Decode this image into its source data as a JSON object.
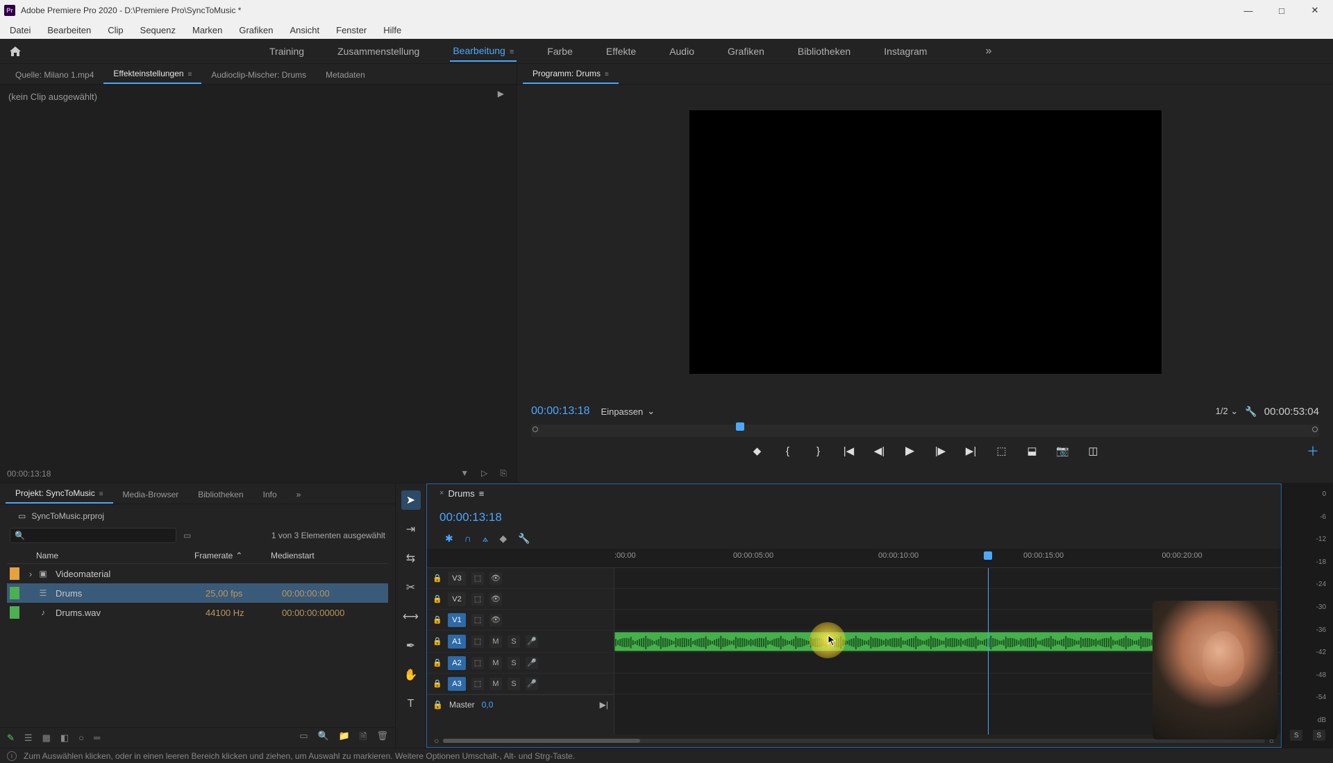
{
  "titlebar": {
    "app_icon_text": "Pr",
    "title": "Adobe Premiere Pro 2020 - D:\\Premiere Pro\\SyncToMusic *"
  },
  "menu": {
    "items": [
      "Datei",
      "Bearbeiten",
      "Clip",
      "Sequenz",
      "Marken",
      "Grafiken",
      "Ansicht",
      "Fenster",
      "Hilfe"
    ]
  },
  "workspaces": {
    "items": [
      "Training",
      "Zusammenstellung",
      "Bearbeitung",
      "Farbe",
      "Effekte",
      "Audio",
      "Grafiken",
      "Bibliotheken",
      "Instagram"
    ],
    "active_index": 2,
    "overflow_glyph": "»"
  },
  "source_panel": {
    "tabs": [
      "Quelle: Milano 1.mp4",
      "Effekteinstellungen",
      "Audioclip-Mischer: Drums",
      "Metadaten"
    ],
    "active_tab_index": 1,
    "no_clip_text": "(kein Clip ausgewählt)",
    "timecode": "00:00:13:18"
  },
  "program_panel": {
    "tab_label": "Programm: Drums",
    "timecode_in": "00:00:13:18",
    "fit_label": "Einpassen",
    "scale_label": "1/2",
    "timecode_out": "00:00:53:04",
    "playhead_percent": 26
  },
  "project_panel": {
    "tabs": [
      "Projekt: SyncToMusic",
      "Media-Browser",
      "Bibliotheken",
      "Info"
    ],
    "overflow_glyph": "»",
    "project_file": "SyncToMusic.prproj",
    "selection_text": "1 von 3 Elementen ausgewählt",
    "columns": {
      "name": "Name",
      "framerate": "Framerate",
      "medienstart": "Medienstart"
    },
    "rows": [
      {
        "chip": "orange",
        "expandable": true,
        "icon": "folder",
        "name": "Videomaterial",
        "framerate": "",
        "medienstart": ""
      },
      {
        "chip": "green",
        "expandable": false,
        "icon": "sequence",
        "name": "Drums",
        "framerate": "25,00 fps",
        "medienstart": "00:00:00:00",
        "selected": true
      },
      {
        "chip": "green",
        "expandable": false,
        "icon": "audio",
        "name": "Drums.wav",
        "framerate": "44100  Hz",
        "medienstart": "00:00:00:00000"
      }
    ]
  },
  "timeline": {
    "tab_label": "Drums",
    "timecode": "00:00:13:18",
    "ruler_ticks": [
      {
        "label": ":00:00",
        "percent": 0
      },
      {
        "label": "00:00:05:00",
        "percent": 18
      },
      {
        "label": "00:00:10:00",
        "percent": 40
      },
      {
        "label": "00:00:15:00",
        "percent": 62
      },
      {
        "label": "00:00:20:00",
        "percent": 83
      }
    ],
    "playhead_percent": 56,
    "cursor_percent": 32,
    "tracks_video": [
      {
        "label": "V3",
        "active": false
      },
      {
        "label": "V2",
        "active": false
      },
      {
        "label": "V1",
        "active": true
      }
    ],
    "tracks_audio": [
      {
        "label": "A1",
        "active": true,
        "clip": {
          "start_percent": 0,
          "width_percent": 86,
          "selected": true
        }
      },
      {
        "label": "A2",
        "active": true
      },
      {
        "label": "A3",
        "active": true
      }
    ],
    "master_label": "Master",
    "master_value": "0,0"
  },
  "meters": {
    "scale": [
      "0",
      "-6",
      "-12",
      "-18",
      "-24",
      "-30",
      "-36",
      "-42",
      "-48",
      "-54",
      "dB"
    ],
    "solo_label": "S"
  },
  "statusbar": {
    "text": "Zum Auswählen klicken, oder in einen leeren Bereich klicken und ziehen, um Auswahl zu markieren. Weitere Optionen Umschalt-, Alt- und Strg-Taste."
  }
}
